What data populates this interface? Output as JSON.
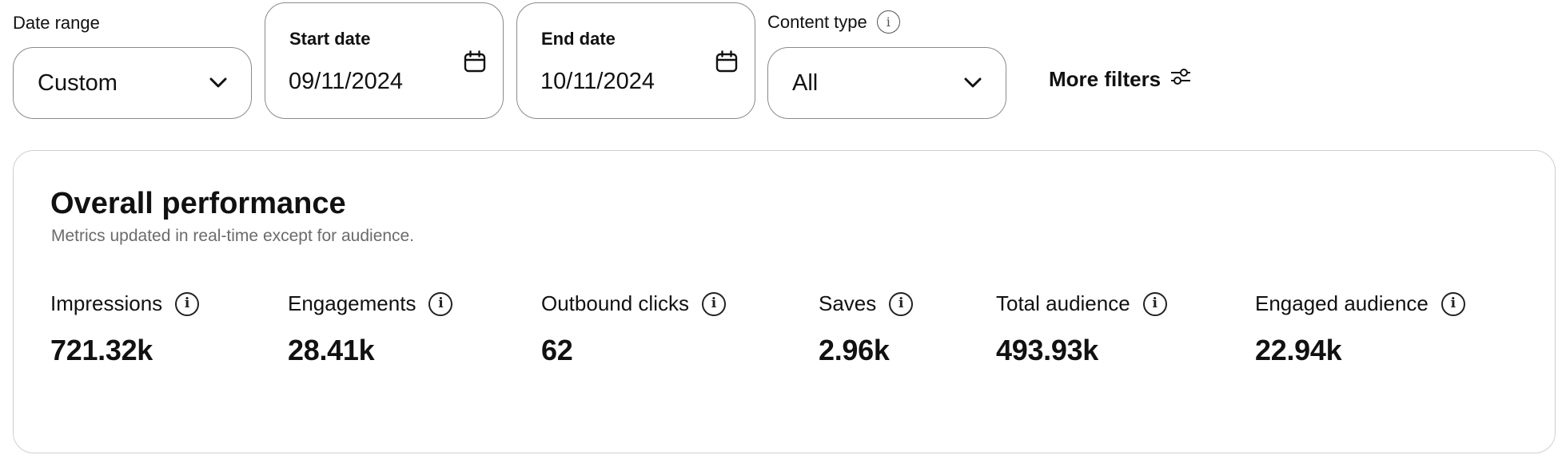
{
  "filters": {
    "date_range": {
      "label": "Date range",
      "value": "Custom"
    },
    "start_date": {
      "label": "Start date",
      "value": "09/11/2024"
    },
    "end_date": {
      "label": "End date",
      "value": "10/11/2024"
    },
    "content_type": {
      "label": "Content type",
      "value": "All",
      "info_icon": "info-icon"
    },
    "more_filters": {
      "label": "More filters",
      "icon": "sliders-icon"
    }
  },
  "performance": {
    "title": "Overall performance",
    "subtitle": "Metrics updated in real-time except for audience.",
    "metrics": [
      {
        "label": "Impressions",
        "value": "721.32k"
      },
      {
        "label": "Engagements",
        "value": "28.41k"
      },
      {
        "label": "Outbound clicks",
        "value": "62"
      },
      {
        "label": "Saves",
        "value": "2.96k"
      },
      {
        "label": "Total audience",
        "value": "493.93k"
      },
      {
        "label": "Engaged audience",
        "value": "22.94k"
      }
    ]
  },
  "colors": {
    "text": "#111111",
    "muted": "#6b6b6b",
    "input_border": "#8a8a8a",
    "card_border": "#cfcfcf"
  }
}
